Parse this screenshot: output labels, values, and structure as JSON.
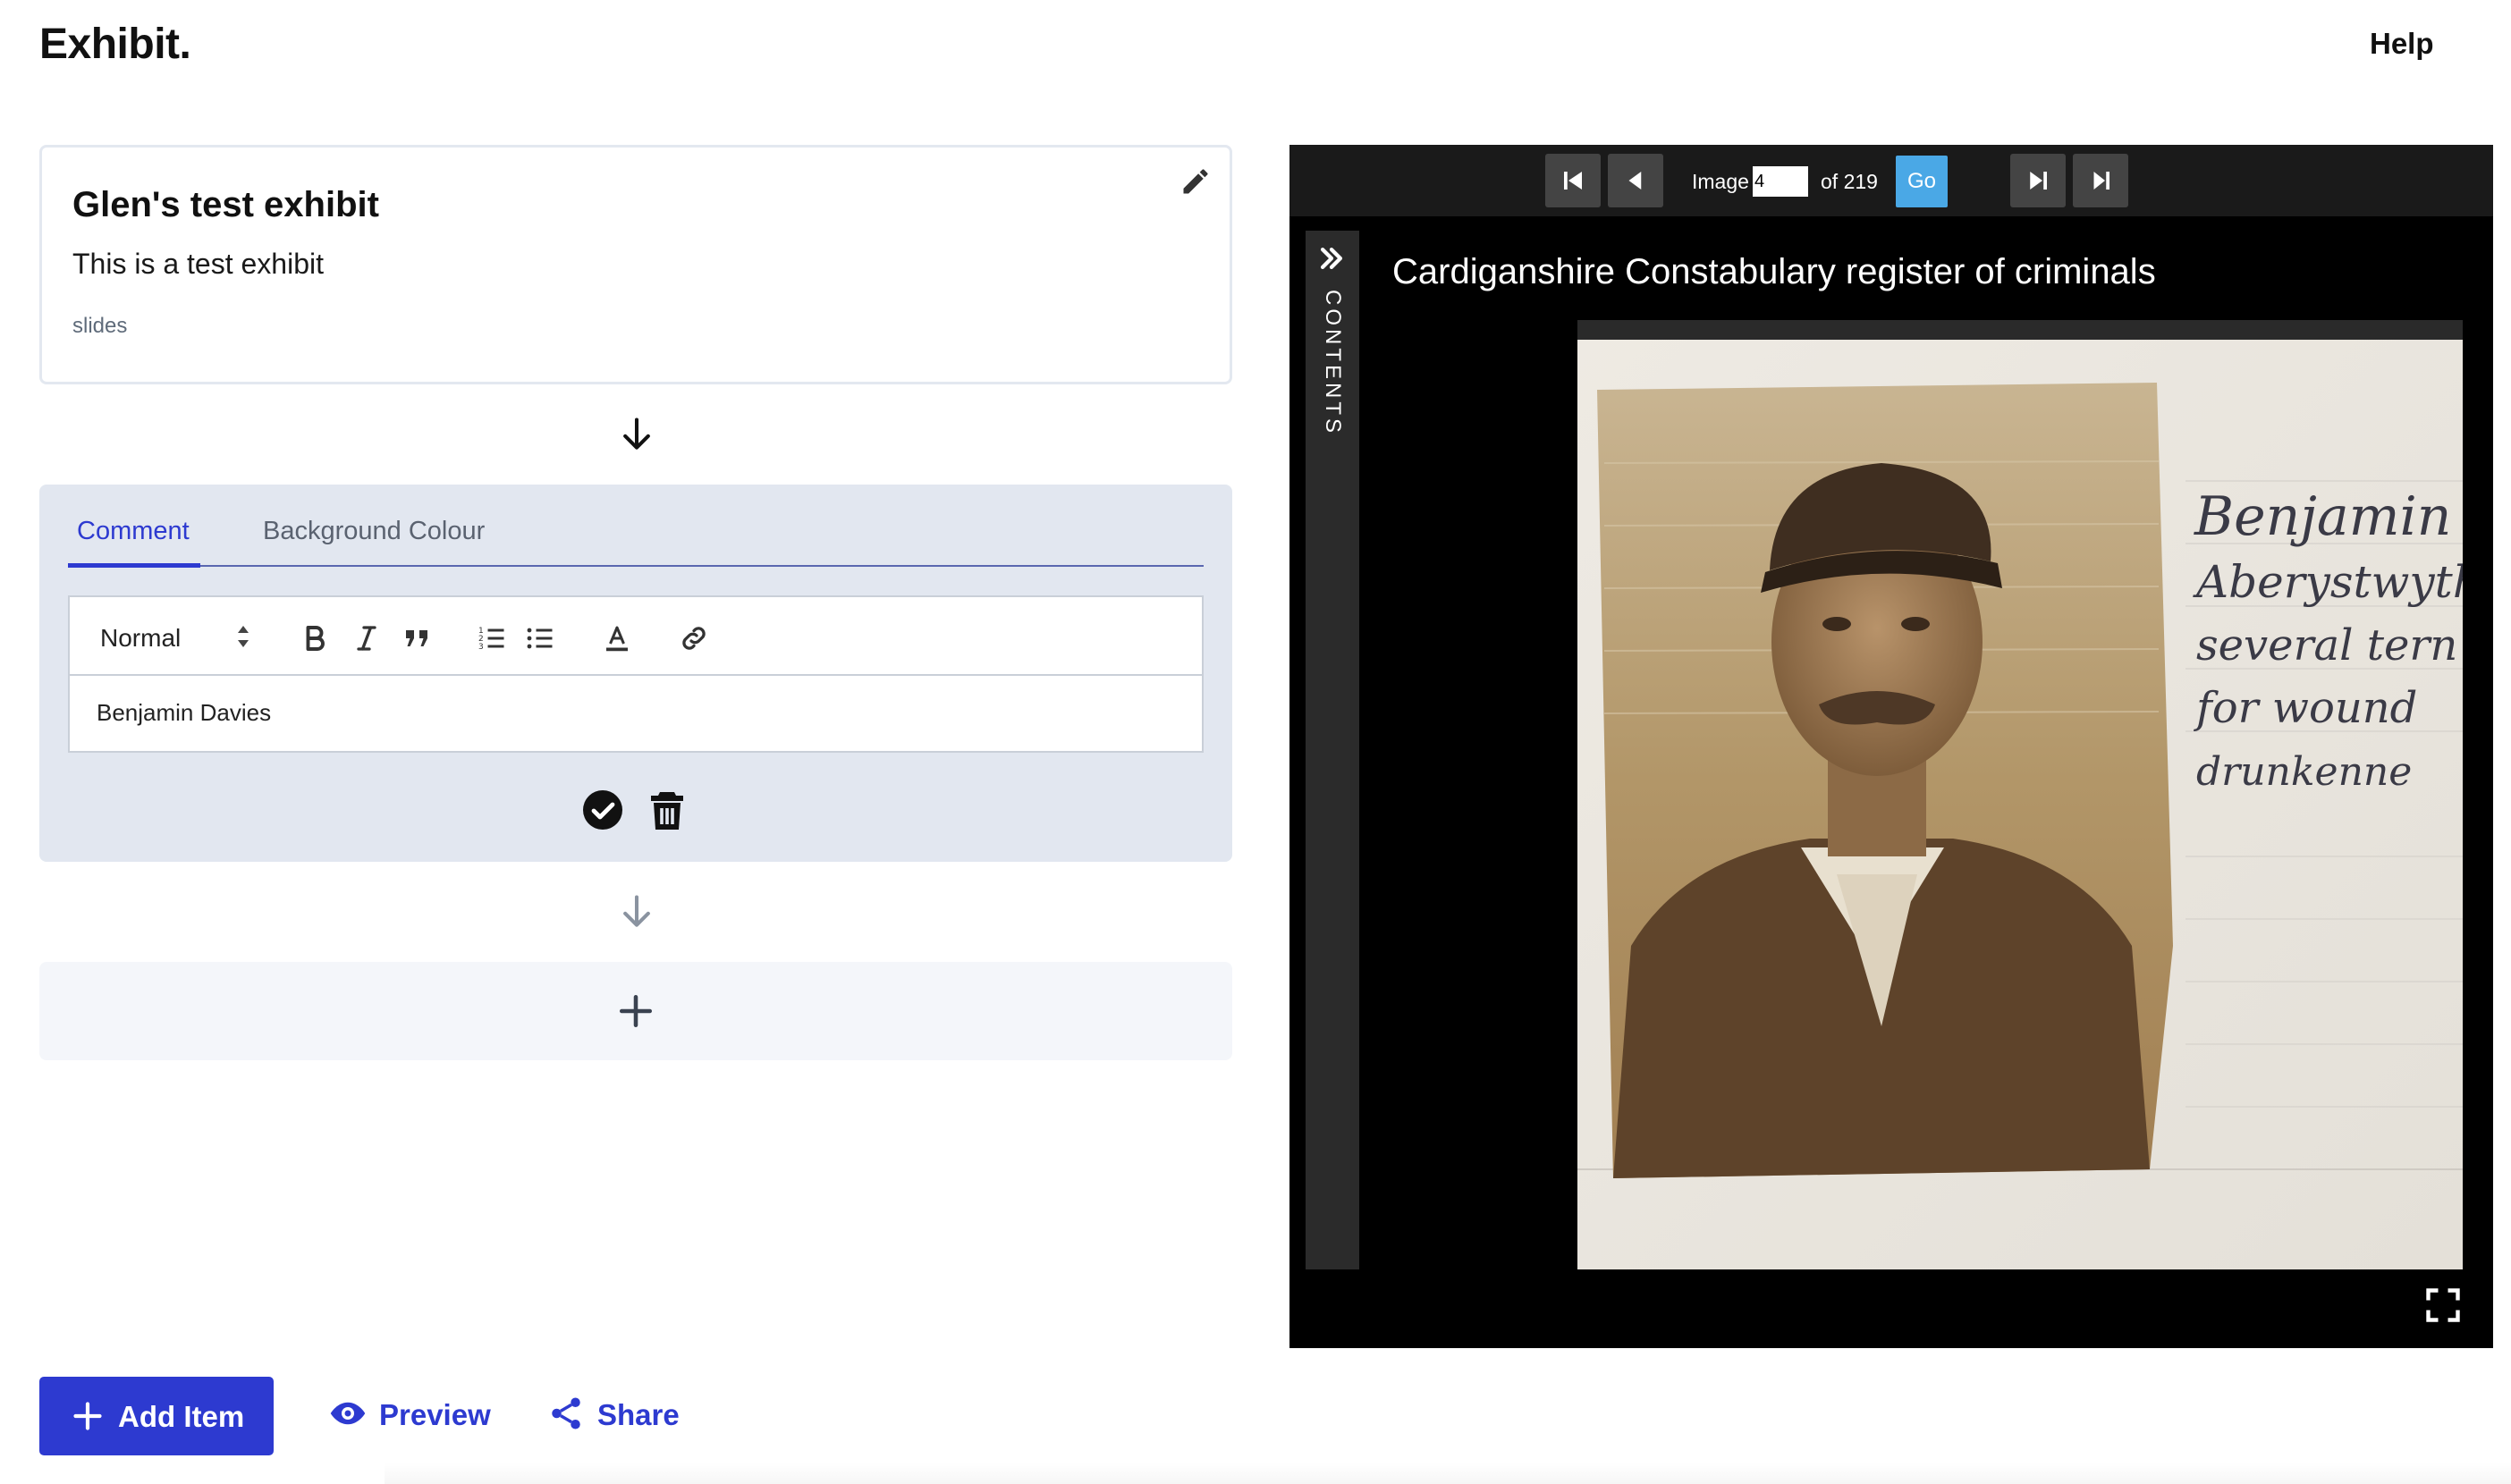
{
  "app": {
    "logo": "Exhibit.",
    "help": "Help"
  },
  "exhibit": {
    "title": "Glen's test exhibit",
    "description": "This is a test exhibit",
    "type": "slides"
  },
  "item_editor": {
    "tabs": [
      {
        "label": "Comment",
        "active": true
      },
      {
        "label": "Background Colour",
        "active": false
      }
    ],
    "toolbar": {
      "format_value": "Normal"
    },
    "content": "Benjamin Davies"
  },
  "actions": {
    "add_item": "Add Item",
    "preview": "Preview",
    "share": "Share"
  },
  "viewer": {
    "image_label": "Image",
    "current_image": "4",
    "of_label": "of 219",
    "go": "Go",
    "contents": "CONTENTS",
    "title": "Cardiganshire Constabulary register of criminals",
    "handwriting": [
      "Benjamin",
      "Aberystwyth",
      "several tern",
      "for wound",
      "drunkenne"
    ]
  },
  "colors": {
    "accent": "#2d3ad0",
    "go_button": "#4aa8e6",
    "panel_bg": "#e2e7f0",
    "viewer_bg": "#000000"
  }
}
